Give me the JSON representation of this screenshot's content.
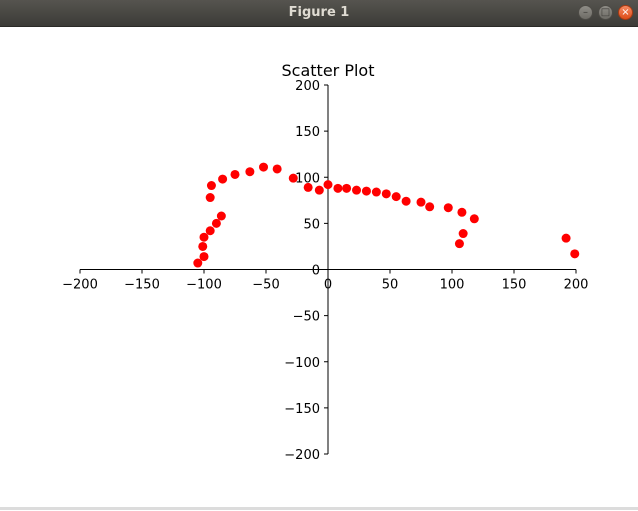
{
  "window": {
    "title": "Figure 1",
    "minimize_icon": "minimize-icon",
    "maximize_icon": "maximize-icon",
    "close_icon": "close-icon"
  },
  "chart_data": {
    "type": "scatter",
    "title": "Scatter Plot",
    "xlabel": "",
    "ylabel": "",
    "xlim": [
      -200,
      200
    ],
    "ylim": [
      -200,
      200
    ],
    "xticks": [
      -200,
      -150,
      -100,
      -50,
      0,
      50,
      100,
      150,
      200
    ],
    "yticks": [
      -200,
      -150,
      -100,
      -50,
      0,
      50,
      100,
      150,
      200
    ],
    "xtick_labels": [
      "−200",
      "−150",
      "−100",
      "−50",
      "0",
      "50",
      "100",
      "150",
      "200"
    ],
    "ytick_labels": [
      "−200",
      "−150",
      "−100",
      "−50",
      "0",
      "50",
      "100",
      "150",
      "200"
    ],
    "grid": false,
    "axes_style": "spines centered at zero",
    "color": "#ff0000",
    "points": [
      [
        -105,
        7
      ],
      [
        -100,
        14
      ],
      [
        -101,
        25
      ],
      [
        -100,
        35
      ],
      [
        -95,
        42
      ],
      [
        -90,
        50
      ],
      [
        -86,
        58
      ],
      [
        -95,
        78
      ],
      [
        -94,
        91
      ],
      [
        -85,
        98
      ],
      [
        -75,
        103
      ],
      [
        -63,
        106
      ],
      [
        -52,
        111
      ],
      [
        -41,
        109
      ],
      [
        -28,
        99
      ],
      [
        -16,
        89
      ],
      [
        -7,
        86
      ],
      [
        0,
        92
      ],
      [
        8,
        88
      ],
      [
        15,
        88
      ],
      [
        23,
        86
      ],
      [
        31,
        85
      ],
      [
        39,
        84
      ],
      [
        47,
        82
      ],
      [
        55,
        79
      ],
      [
        63,
        74
      ],
      [
        75,
        73
      ],
      [
        82,
        68
      ],
      [
        97,
        67
      ],
      [
        108,
        62
      ],
      [
        118,
        55
      ],
      [
        109,
        39
      ],
      [
        106,
        28
      ],
      [
        192,
        34
      ],
      [
        199,
        17
      ]
    ]
  }
}
